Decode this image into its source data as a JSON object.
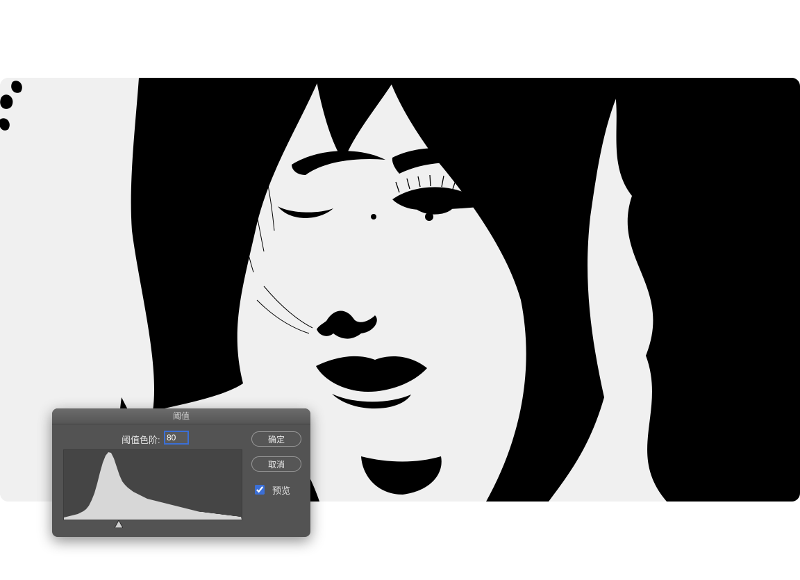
{
  "chart_data": {
    "type": "area",
    "title": "",
    "xlabel": "",
    "ylabel": "",
    "xlim": [
      0,
      255
    ],
    "ylim": [
      0,
      100
    ],
    "series": [
      {
        "name": "histogram",
        "x": [
          0,
          4,
          8,
          12,
          16,
          20,
          24,
          28,
          32,
          36,
          40,
          44,
          48,
          52,
          56,
          60,
          64,
          68,
          72,
          76,
          80,
          84,
          88,
          92,
          96,
          100,
          104,
          108,
          112,
          116,
          120,
          124,
          128,
          132,
          136,
          140,
          144,
          148,
          152,
          156,
          160,
          164,
          168,
          172,
          176,
          180,
          184,
          188,
          192,
          196,
          200,
          204,
          208,
          212,
          216,
          220,
          224,
          228,
          232,
          236,
          240,
          244,
          248,
          252,
          255
        ],
        "values": [
          3,
          4,
          5,
          6,
          7,
          8,
          10,
          12,
          15,
          20,
          28,
          38,
          52,
          68,
          82,
          92,
          97,
          96,
          88,
          76,
          64,
          55,
          50,
          46,
          43,
          40,
          38,
          36,
          34,
          32,
          30,
          29,
          28,
          27,
          26,
          25,
          24,
          23,
          22,
          21,
          20,
          19,
          18,
          17,
          16,
          15,
          14,
          13,
          12,
          11,
          11,
          10,
          10,
          9,
          9,
          8,
          8,
          7,
          7,
          6,
          6,
          5,
          5,
          4,
          4
        ]
      }
    ]
  },
  "dialog": {
    "title": "阈值",
    "threshold_label": "阈值色阶:",
    "threshold_value": "80",
    "threshold_min": 0,
    "threshold_max": 255,
    "ok_label": "确定",
    "cancel_label": "取消",
    "preview_label": "预览",
    "preview_checked": true
  },
  "colors": {
    "panel": "#f0f0f0",
    "dialog_bg": "#535353",
    "dialog_title_bg_top": "#6c6c6c",
    "dialog_title_bg_bottom": "#565656",
    "histo_bg": "#454545",
    "histo_fill": "#d7d7d7",
    "accent": "#3b6fd6"
  }
}
